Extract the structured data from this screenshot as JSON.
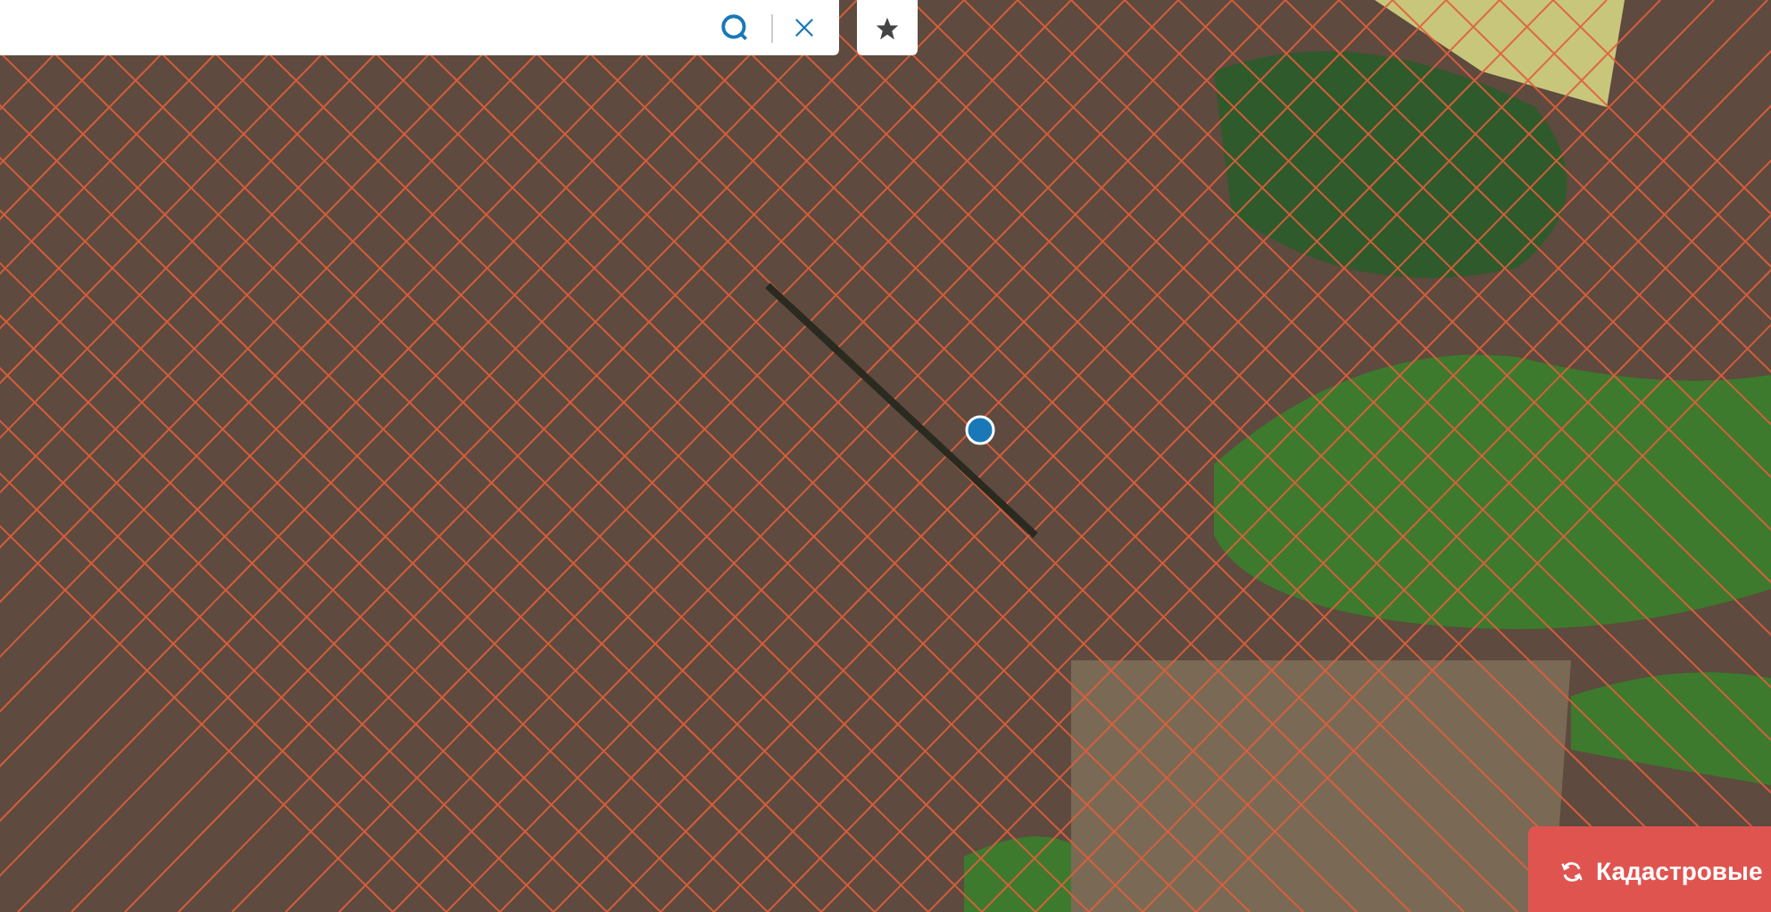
{
  "cadastre_button": {
    "label": "Кадастровые"
  }
}
